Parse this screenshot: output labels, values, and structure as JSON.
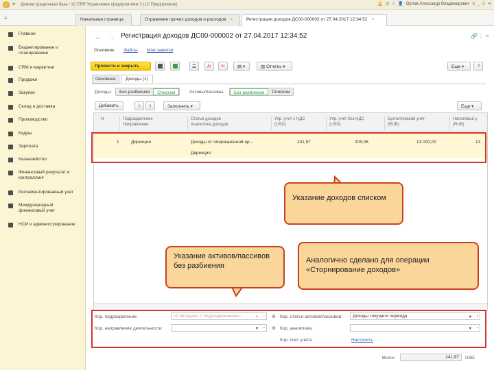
{
  "titlebar": {
    "menu": "≡",
    "title": "Демонстрационная база / 1С:ERP Управление предприятием 2 (1С:Предприятие)",
    "user": "Орлов Александр Владимирович"
  },
  "tabs": [
    {
      "label": "Начальная страница"
    },
    {
      "label": "Отражение прочих доходов и расходов"
    },
    {
      "label": "Регистрация доходов ДС00-000002 от 27.04.2017 12:34:52"
    }
  ],
  "sidebar": {
    "items": [
      {
        "label": "Главное",
        "icon": "menu-icon"
      },
      {
        "label": "Бюджетирование и планирование",
        "icon": "budget-icon"
      },
      {
        "label": "CRM и маркетинг",
        "icon": "crm-icon"
      },
      {
        "label": "Продажи",
        "icon": "sales-icon"
      },
      {
        "label": "Закупки",
        "icon": "purchases-icon"
      },
      {
        "label": "Склад и доставка",
        "icon": "warehouse-icon"
      },
      {
        "label": "Производство",
        "icon": "production-icon"
      },
      {
        "label": "Кадры",
        "icon": "hr-icon"
      },
      {
        "label": "Зарплата",
        "icon": "salary-icon"
      },
      {
        "label": "Казначейство",
        "icon": "treasury-icon"
      },
      {
        "label": "Финансовый результат и контроллинг",
        "icon": "finance-icon"
      },
      {
        "label": "Регламентированный учет",
        "icon": "accounting-icon"
      },
      {
        "label": "Международный финансовый учет",
        "icon": "intl-icon"
      },
      {
        "label": "НСИ и администрирование",
        "icon": "admin-icon"
      }
    ]
  },
  "doc": {
    "title": "Регистрация доходов ДС00-000002 от 27.04.2017 12:34:52",
    "links": [
      "Основное",
      "Файлы",
      "Мои заметки"
    ],
    "post_close": "Провести и закрыть",
    "reports": "Отчеты",
    "more": "Еще",
    "help": "?",
    "subtabs": [
      "Основное",
      "Доходы (1)"
    ]
  },
  "filters": {
    "income_label": "Доходы:",
    "income_opts": [
      "Без разбиения",
      "Списком"
    ],
    "assets_label": "Активы/пассивы:",
    "assets_opts": [
      "Без разбиения",
      "Списком"
    ]
  },
  "table_toolbar": {
    "add": "Добавить",
    "fill": "Заполнить",
    "more": "Еще"
  },
  "table": {
    "headers": [
      {
        "l1": "N",
        "l2": ""
      },
      {
        "l1": "Подразделение",
        "l2": "Направление"
      },
      {
        "l1": "Статья доходов",
        "l2": "Аналитика доходов"
      },
      {
        "l1": "Упр. учет с НДС",
        "l2": "(USD)"
      },
      {
        "l1": "Упр. учет без НДС",
        "l2": "(USD)"
      },
      {
        "l1": "Бухгалтерский учет",
        "l2": "(RUB)"
      },
      {
        "l1": "Налоговый у",
        "l2": "(RUB)"
      }
    ],
    "row": {
      "n": "1",
      "dept": "Дирекция",
      "article": "Доходы от операционной ар...",
      "analytics": "Дирекция",
      "upr_vat": "241,97",
      "upr_novat": "205,06",
      "buh": "13 000,00",
      "tax": "13"
    }
  },
  "bottom": {
    "kor_dept_label": "Кор. подразделение:",
    "kor_dept_placeholder": "<Совпадает с подразделением>",
    "kor_dir_label": "Кор. направление деятельности:",
    "kor_article_label": "Кор. статья активов/пассивов:",
    "kor_article_value": "Доходы текущего периода",
    "kor_analytics_label": "Кор. аналитика:",
    "kor_account_label": "Кор. счет учета:",
    "kor_account_link": "Настроить"
  },
  "total": {
    "label": "Всего:",
    "value": "241,97",
    "currency": "USD"
  },
  "callouts": {
    "list": "Указание доходов списком",
    "assets": "Указание активов/пассивов без разбиения",
    "storno": "Аналогично сделано для операции «Сторнирование доходов»"
  },
  "colors": {
    "sidebar_bg": "#fbf5d3",
    "accent_yellow": "#f5c800",
    "highlight_red": "#d2342b",
    "callout_bg": "#fad69a",
    "active_green": "#2b9b3e"
  }
}
